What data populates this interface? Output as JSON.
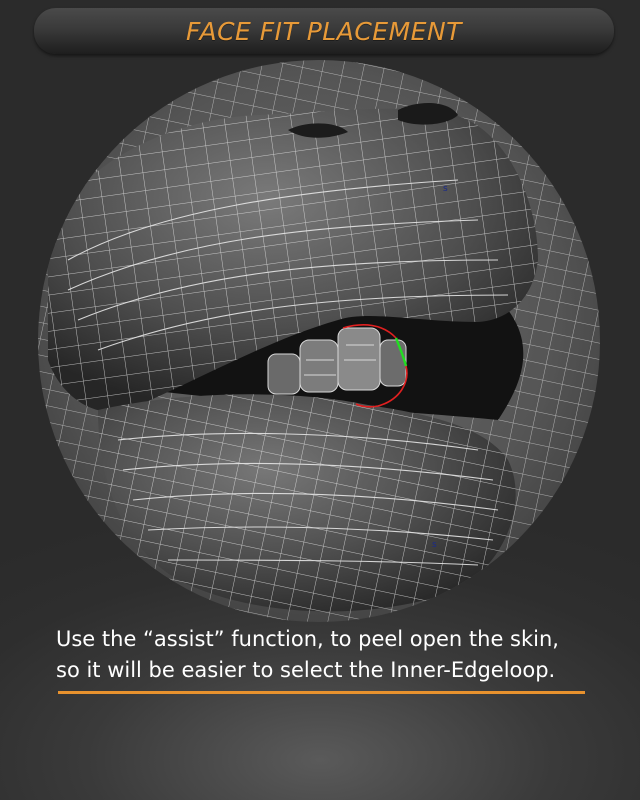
{
  "header": {
    "title": "FACE FIT PLACEMENT"
  },
  "caption": {
    "line1": "Use the “assist” function, to peel open the skin,",
    "line2": "so it will be easier to select the Inner-Edgeloop."
  },
  "render": {
    "markers": [
      "s",
      "s"
    ]
  },
  "colors": {
    "accent": "#e8922e",
    "title_text": "#e89a38",
    "background": "#2f2f2f",
    "wire": "#e6e6e6",
    "edge_highlight_red": "#e02020",
    "edge_highlight_green": "#22dd22",
    "marker": "#1a2a8a"
  }
}
